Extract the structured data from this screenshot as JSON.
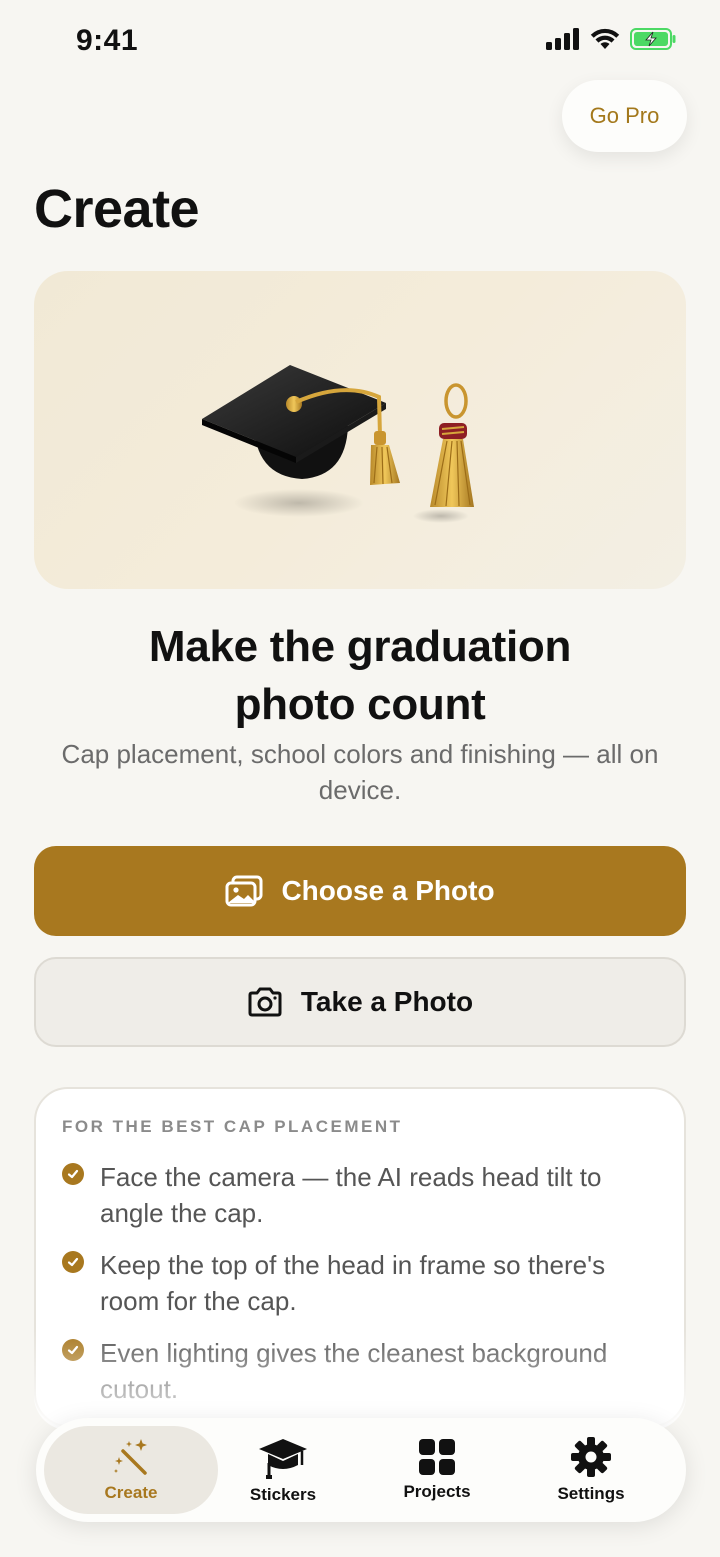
{
  "status_bar": {
    "time": "9:41"
  },
  "header": {
    "go_pro_label": "Go Pro",
    "title": "Create"
  },
  "hero": {
    "headline_line1": "Make the graduation",
    "headline_line2": "photo count",
    "subhead": "Cap placement, school colors and finishing — all on device."
  },
  "actions": {
    "choose_photo_label": "Choose a Photo",
    "take_photo_label": "Take a Photo"
  },
  "tips": {
    "heading": "FOR THE BEST CAP PLACEMENT",
    "items": [
      "Face the camera — the AI reads head tilt to angle the cap.",
      "Keep the top of the head in frame so there's room for the cap.",
      "Even lighting gives the cleanest background cutout."
    ]
  },
  "tab_bar": {
    "items": [
      {
        "label": "Create",
        "icon": "magic-wand-icon",
        "active": true
      },
      {
        "label": "Stickers",
        "icon": "graduation-cap-icon",
        "active": false
      },
      {
        "label": "Projects",
        "icon": "grid-icon",
        "active": false
      },
      {
        "label": "Settings",
        "icon": "gear-icon",
        "active": false
      }
    ]
  },
  "colors": {
    "accent": "#a8781f",
    "background": "#f7f6f2",
    "battery": "#4cd964"
  }
}
